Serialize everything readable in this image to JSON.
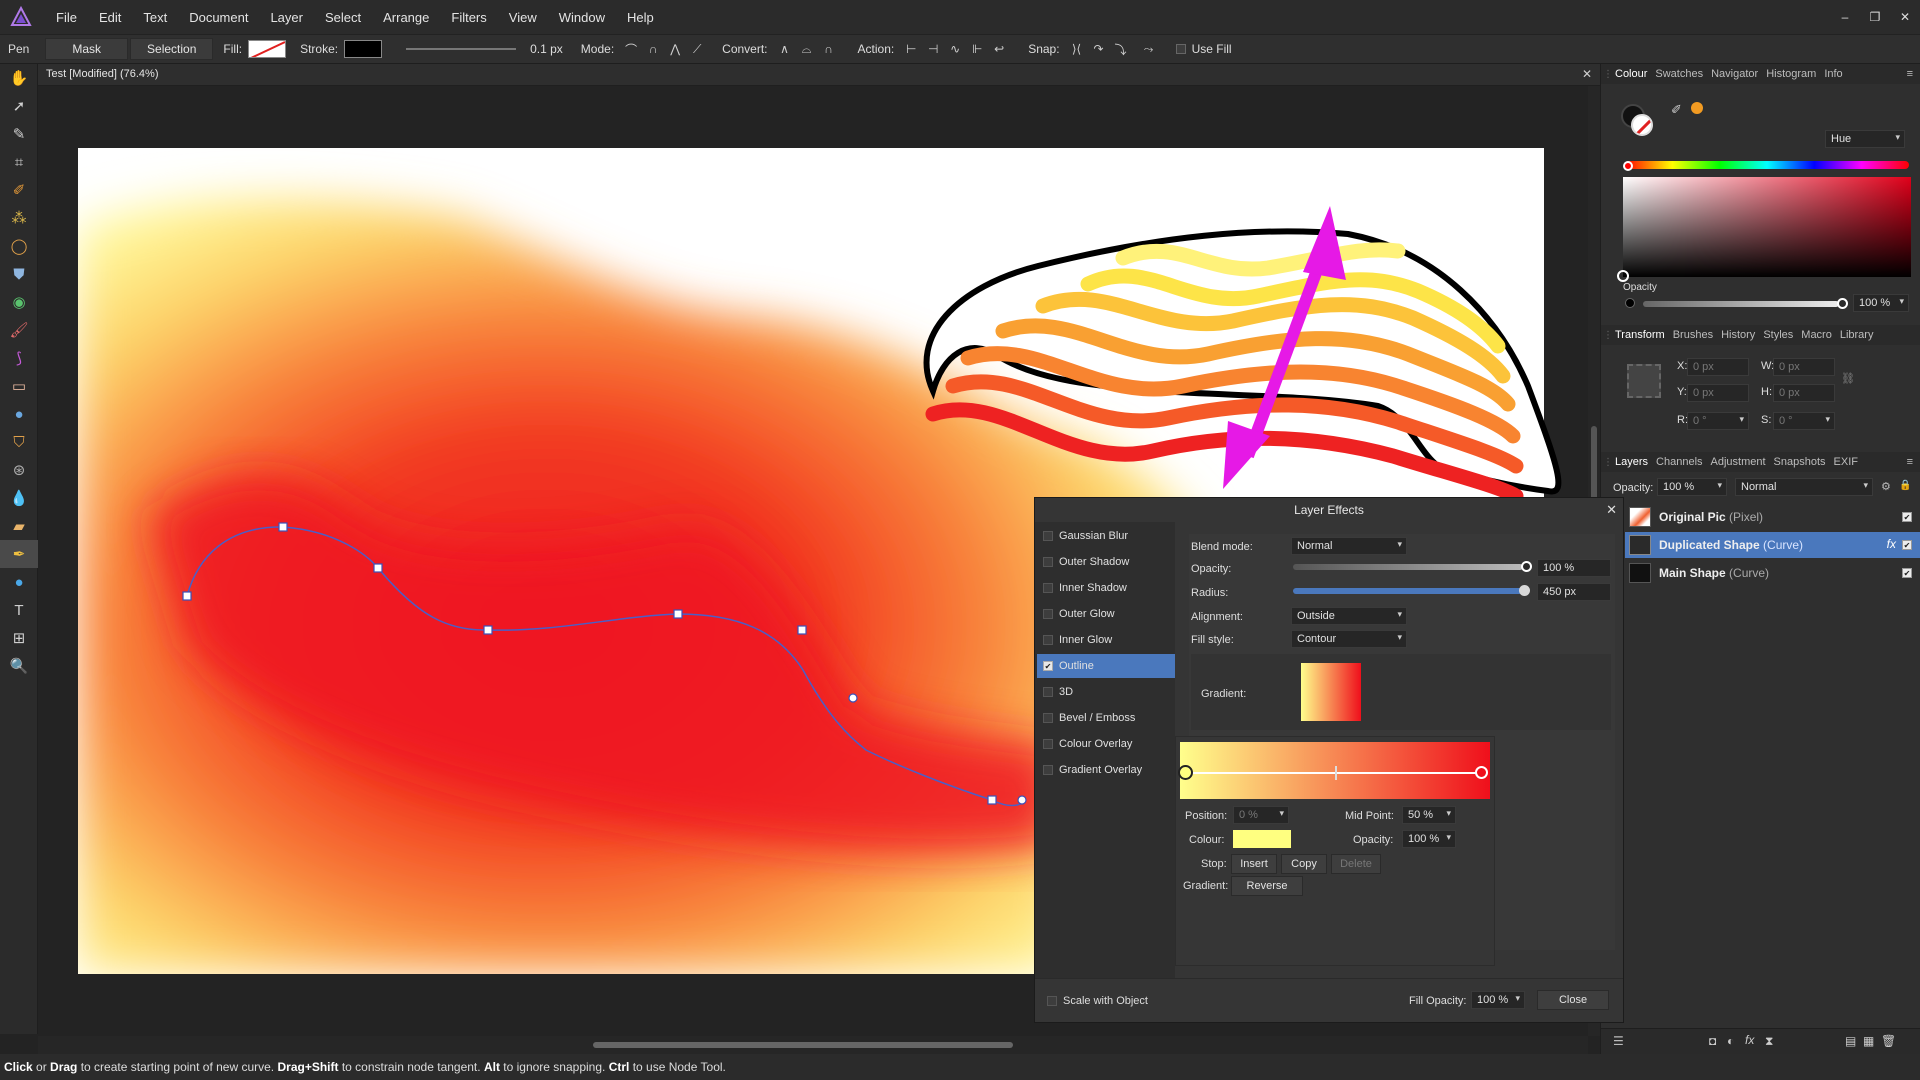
{
  "menu": [
    "File",
    "Edit",
    "Text",
    "Document",
    "Layer",
    "Select",
    "Arrange",
    "Filters",
    "View",
    "Window",
    "Help"
  ],
  "window_controls": [
    "–",
    "❐",
    "✕"
  ],
  "context": {
    "tool": "Pen",
    "mask": "Mask",
    "selection": "Selection",
    "fill_label": "Fill:",
    "stroke_label": "Stroke:",
    "stroke_width": "0.1 px",
    "mode_label": "Mode:",
    "convert_label": "Convert:",
    "action_label": "Action:",
    "snap_label": "Snap:",
    "use_fill": "Use Fill"
  },
  "document": {
    "title": "Test [Modified] (76.4%)",
    "close": "✕"
  },
  "colour_panel": {
    "tabs": [
      "Colour",
      "Swatches",
      "Navigator",
      "Histogram",
      "Info"
    ],
    "mode": "Hue",
    "opacity_label": "Opacity",
    "opacity": "100 %",
    "accent": "#f29b22"
  },
  "transform_panel": {
    "tabs": [
      "Transform",
      "Brushes",
      "History",
      "Styles",
      "Macro",
      "Library"
    ],
    "x": "0 px",
    "y": "0 px",
    "w": "0 px",
    "h": "0 px",
    "r": "0 °",
    "s": "0 °",
    "x_label": "X:",
    "y_label": "Y:",
    "w_label": "W:",
    "h_label": "H:",
    "r_label": "R:",
    "s_label": "S:"
  },
  "layers_panel": {
    "tabs": [
      "Layers",
      "Channels",
      "Adjustment",
      "Snapshots",
      "EXIF"
    ],
    "opacity_label": "Opacity:",
    "opacity": "100 %",
    "blend": "Normal",
    "layers": [
      {
        "name": "Original Pic",
        "kind": "(Pixel)"
      },
      {
        "name": "Duplicated Shape",
        "kind": "(Curve)",
        "fx": "fx"
      },
      {
        "name": "Main Shape",
        "kind": "(Curve)"
      }
    ]
  },
  "fx_dialog": {
    "title": "Layer Effects",
    "effects": [
      "Gaussian Blur",
      "Outer Shadow",
      "Inner Shadow",
      "Outer Glow",
      "Inner Glow",
      "Outline",
      "3D",
      "Bevel / Emboss",
      "Colour Overlay",
      "Gradient Overlay"
    ],
    "active_effect": "Outline",
    "blend_label": "Blend mode:",
    "blend": "Normal",
    "opacity_label": "Opacity:",
    "opacity": "100 %",
    "opacity_value": 1.0,
    "radius_label": "Radius:",
    "radius": "450 px",
    "alignment_label": "Alignment:",
    "alignment": "Outside",
    "fill_style_label": "Fill style:",
    "fill_style": "Contour",
    "gradient_label": "Gradient:",
    "gradient_start": "#ffff8c",
    "gradient_end": "#ef0f1b",
    "position_label": "Position:",
    "position": "0 %",
    "midpoint_label": "Mid Point:",
    "midpoint": "50 %",
    "colour_label": "Colour:",
    "stop_colour": "#ffff80",
    "stop_opacity_label": "Opacity:",
    "stop_opacity": "100 %",
    "stop_label": "Stop:",
    "insert": "Insert",
    "copy": "Copy",
    "delete": "Delete",
    "gradient2_label": "Gradient:",
    "reverse": "Reverse",
    "scale_with_object": "Scale with Object",
    "fill_opacity_label": "Fill Opacity:",
    "fill_opacity": "100 %",
    "close": "Close"
  },
  "status": {
    "k1": "Click",
    "t1": " or ",
    "k2": "Drag",
    "t2": " to create starting point of new curve. ",
    "k3": "Drag+Shift",
    "t3": " to constrain node tangent. ",
    "k4": "Alt",
    "t4": " to ignore snapping. ",
    "k5": "Ctrl",
    "t5": " to use Node Tool."
  }
}
